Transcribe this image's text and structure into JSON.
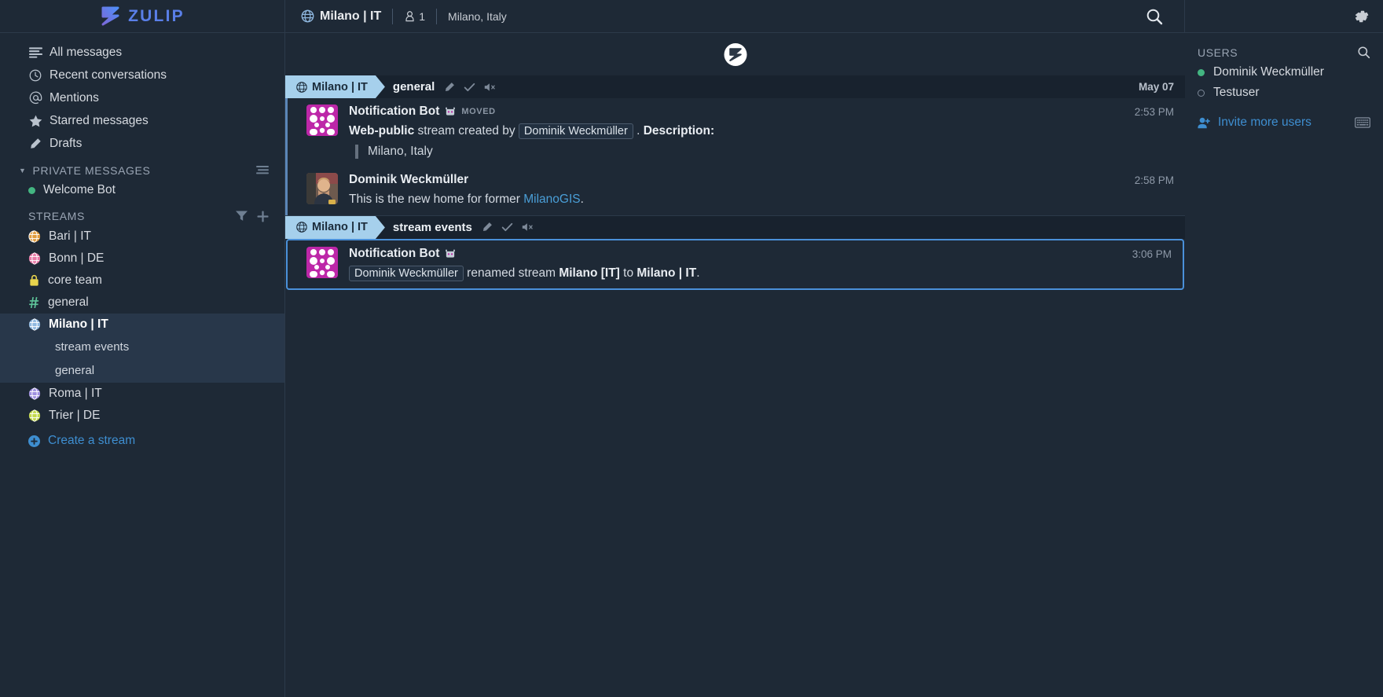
{
  "app": {
    "brand": "ZULIP",
    "logo_icon": "zulip-z-logo",
    "settings_icon": "gear-icon"
  },
  "header": {
    "stream_icon": "globe-icon",
    "stream_name": "Milano | IT",
    "subscriber_icon": "person-icon",
    "subscriber_count": "1",
    "description": "Milano, Italy",
    "search_icon": "search-icon"
  },
  "sidebar": {
    "nav_items": [
      {
        "label": "All messages",
        "icon": "all-messages-icon"
      },
      {
        "label": "Recent conversations",
        "icon": "clock-icon"
      },
      {
        "label": "Mentions",
        "icon": "at-icon"
      },
      {
        "label": "Starred messages",
        "icon": "star-icon"
      },
      {
        "label": "Drafts",
        "icon": "pencil-icon"
      }
    ],
    "private_messages": {
      "label": "PRIVATE MESSAGES",
      "caret_icon": "caret-down-icon",
      "action_icon": "filter-users-icon",
      "items": [
        {
          "name": "Welcome Bot",
          "status": "active"
        }
      ]
    },
    "streams": {
      "label": "STREAMS",
      "filter_icon": "filter-icon",
      "add_icon": "plus-icon",
      "items": [
        {
          "name": "Bari | IT",
          "icon": "globe-icon",
          "color": "#e09b3d"
        },
        {
          "name": "Bonn | DE",
          "icon": "globe-icon",
          "color": "#e879a6"
        },
        {
          "name": "core team",
          "icon": "lock-icon",
          "color": "#e8d44d"
        },
        {
          "name": "general",
          "icon": "hash-icon",
          "color": "#5ec49a"
        },
        {
          "name": "Milano | IT",
          "icon": "globe-icon",
          "color": "#8fb8e0",
          "active": true,
          "topics": [
            "stream events",
            "general"
          ]
        },
        {
          "name": "Roma | IT",
          "icon": "globe-icon",
          "color": "#9e8fe0"
        },
        {
          "name": "Trier | DE",
          "icon": "globe-icon",
          "color": "#c3d84a"
        }
      ]
    },
    "create_stream": {
      "label": "Create a stream",
      "icon": "plus-circle-icon"
    }
  },
  "message_groups": [
    {
      "stream_tag": "Milano | IT",
      "stream_icon": "globe-icon",
      "topic": "general",
      "edit_icon": "pencil-icon",
      "resolve_icon": "check-icon",
      "mute_icon": "mute-speaker-icon",
      "date": "May 07",
      "highlighted": false,
      "messages": [
        {
          "sender": "Notification Bot",
          "avatar_type": "identicon-magenta",
          "bot_badge_icon": "bot-icon",
          "moved_tag": "MOVED",
          "time": "2:53 PM",
          "body_parts": [
            {
              "type": "bold",
              "text": "Web-public"
            },
            {
              "type": "text",
              "text": " stream created by "
            },
            {
              "type": "mention",
              "text": "Dominik Weckmüller"
            },
            {
              "type": "text",
              "text": " . "
            },
            {
              "type": "bold",
              "text": "Description:"
            }
          ],
          "blockquote": "Milano, Italy"
        },
        {
          "sender": "Dominik Weckmüller",
          "avatar_type": "photo",
          "time": "2:58 PM",
          "body_parts": [
            {
              "type": "text",
              "text": "This is the new home for former "
            },
            {
              "type": "link",
              "text": "MilanoGIS"
            },
            {
              "type": "text",
              "text": "."
            }
          ]
        }
      ]
    },
    {
      "stream_tag": "Milano | IT",
      "stream_icon": "globe-icon",
      "topic": "stream events",
      "edit_icon": "pencil-icon",
      "resolve_icon": "check-icon",
      "mute_icon": "mute-speaker-icon",
      "date": "",
      "highlighted": true,
      "messages": [
        {
          "sender": "Notification Bot",
          "avatar_type": "identicon-magenta",
          "bot_badge_icon": "bot-icon",
          "time": "3:06 PM",
          "body_parts": [
            {
              "type": "mention",
              "text": "Dominik Weckmüller"
            },
            {
              "type": "text",
              "text": " renamed stream "
            },
            {
              "type": "bold",
              "text": "Milano [IT]"
            },
            {
              "type": "text",
              "text": " to "
            },
            {
              "type": "bold",
              "text": "Milano | IT"
            },
            {
              "type": "text",
              "text": "."
            }
          ]
        }
      ]
    }
  ],
  "right_sidebar": {
    "users_label": "USERS",
    "search_icon": "search-icon",
    "users": [
      {
        "name": "Dominik Weckmüller",
        "status": "active"
      },
      {
        "name": "Testuser",
        "status": "offline"
      }
    ],
    "invite": {
      "label": "Invite more users",
      "icon": "add-user-icon"
    },
    "keyboard_icon": "keyboard-icon"
  },
  "colors": {
    "background": "#1e2936",
    "accent_link": "#3e8ed0",
    "brand": "#5a7fe8",
    "highlight_border": "#4a90d9",
    "recipient_tag": "#a6d0ec",
    "online": "#43b581"
  }
}
